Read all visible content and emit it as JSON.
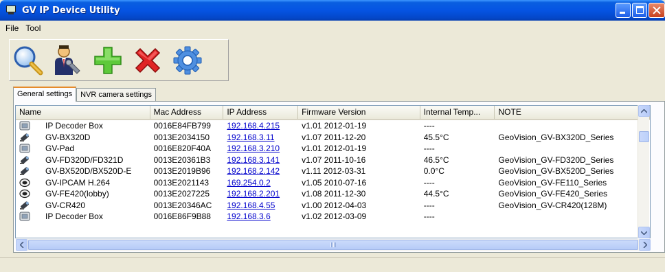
{
  "window": {
    "title": "GV IP Device Utility"
  },
  "menu": {
    "file": "File",
    "tool": "Tool"
  },
  "toolbar": {
    "buttons": [
      {
        "icon": "search-icon"
      },
      {
        "icon": "user-tool-icon"
      },
      {
        "icon": "plus-icon"
      },
      {
        "icon": "delete-icon"
      },
      {
        "icon": "gear-icon"
      }
    ]
  },
  "tabs": [
    {
      "label": "General settings",
      "active": true
    },
    {
      "label": "NVR camera settings",
      "active": false
    }
  ],
  "table": {
    "columns": [
      "Name",
      "Mac Address",
      "IP Address",
      "Firmware Version",
      "Internal Temp...",
      "NOTE"
    ],
    "rows": [
      {
        "icon": "decoder-box-icon",
        "name": "IP Decoder Box",
        "mac": "0016E84FB799",
        "ip": "192.168.4.215",
        "firmware": "v1.01  2012-01-19",
        "temp": "----",
        "note": ""
      },
      {
        "icon": "bullet-camera-icon",
        "name": "GV-BX320D",
        "mac": "0013E2034150",
        "ip": "192.168.3.11",
        "firmware": "v1.07  2011-12-20",
        "temp": "45.5°C",
        "note": "GeoVision_GV-BX320D_Series"
      },
      {
        "icon": "decoder-box-icon",
        "name": "GV-Pad",
        "mac": "0016E820F40A",
        "ip": "192.168.3.210",
        "firmware": "v1.01  2012-01-19",
        "temp": "----",
        "note": ""
      },
      {
        "icon": "bullet-camera-icon",
        "name": "GV-FD320D/FD321D",
        "mac": "0013E20361B3",
        "ip": "192.168.3.141",
        "firmware": "v1.07  2011-10-16",
        "temp": "46.5°C",
        "note": "GeoVision_GV-FD320D_Series"
      },
      {
        "icon": "bullet-camera-icon",
        "name": "GV-BX520D/BX520D-E",
        "mac": "0013E2019B96",
        "ip": "192.168.2.142",
        "firmware": "v1.11  2012-03-31",
        "temp": "0.0°C",
        "note": "GeoVision_GV-BX520D_Series"
      },
      {
        "icon": "dome-camera-icon",
        "name": "GV-IPCAM H.264",
        "mac": "0013E2021143",
        "ip": "169.254.0.2",
        "firmware": "v1.05  2010-07-16",
        "temp": "----",
        "note": "GeoVision_GV-FE110_Series"
      },
      {
        "icon": "dome-camera-icon",
        "name": "GV-FE420(lobby)",
        "mac": "0013E2027225",
        "ip": "192.168.2.201",
        "firmware": "v1.08  2011-12-30",
        "temp": "44.5°C",
        "note": "GeoVision_GV-FE420_Series"
      },
      {
        "icon": "bullet-camera-icon",
        "name": "GV-CR420",
        "mac": "0013E20346AC",
        "ip": "192.168.4.55",
        "firmware": "v1.00  2012-04-03",
        "temp": "----",
        "note": "GeoVision_GV-CR420(128M)"
      },
      {
        "icon": "decoder-box-icon",
        "name": "IP Decoder Box",
        "mac": "0016E86F9B88",
        "ip": "192.168.3.6",
        "firmware": "v1.02  2012-03-09",
        "temp": "----",
        "note": ""
      }
    ]
  }
}
